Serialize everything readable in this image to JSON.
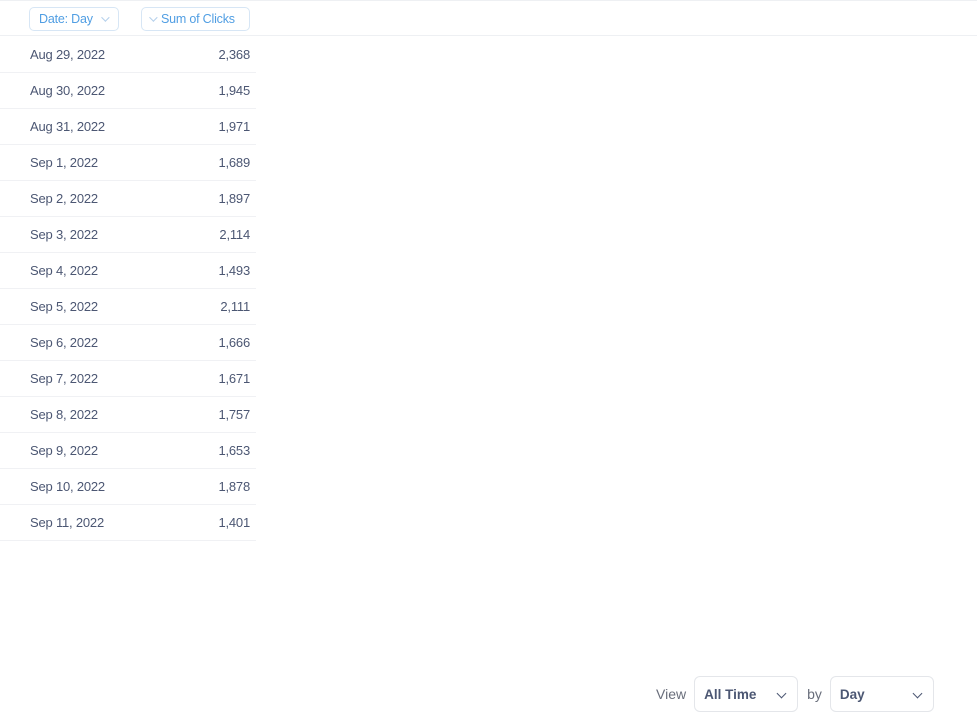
{
  "table": {
    "columns": [
      {
        "label": "Date: Day"
      },
      {
        "label": "Sum of Clicks"
      }
    ],
    "rows": [
      {
        "date": "Aug 29, 2022",
        "value": "2,368"
      },
      {
        "date": "Aug 30, 2022",
        "value": "1,945"
      },
      {
        "date": "Aug 31, 2022",
        "value": "1,971"
      },
      {
        "date": "Sep 1, 2022",
        "value": "1,689"
      },
      {
        "date": "Sep 2, 2022",
        "value": "1,897"
      },
      {
        "date": "Sep 3, 2022",
        "value": "2,114"
      },
      {
        "date": "Sep 4, 2022",
        "value": "1,493"
      },
      {
        "date": "Sep 5, 2022",
        "value": "2,111"
      },
      {
        "date": "Sep 6, 2022",
        "value": "1,666"
      },
      {
        "date": "Sep 7, 2022",
        "value": "1,671"
      },
      {
        "date": "Sep 8, 2022",
        "value": "1,757"
      },
      {
        "date": "Sep 9, 2022",
        "value": "1,653"
      },
      {
        "date": "Sep 10, 2022",
        "value": "1,878"
      },
      {
        "date": "Sep 11, 2022",
        "value": "1,401"
      }
    ]
  },
  "footer": {
    "view_label": "View",
    "view_value": "All Time",
    "by_label": "by",
    "by_value": "Day"
  },
  "colors": {
    "accent": "#509ee3",
    "text": "#4c5773",
    "border": "#e4e6ea"
  },
  "icons": {
    "column_sort": "chevron-down-icon",
    "dropdown": "chevron-down-icon"
  }
}
